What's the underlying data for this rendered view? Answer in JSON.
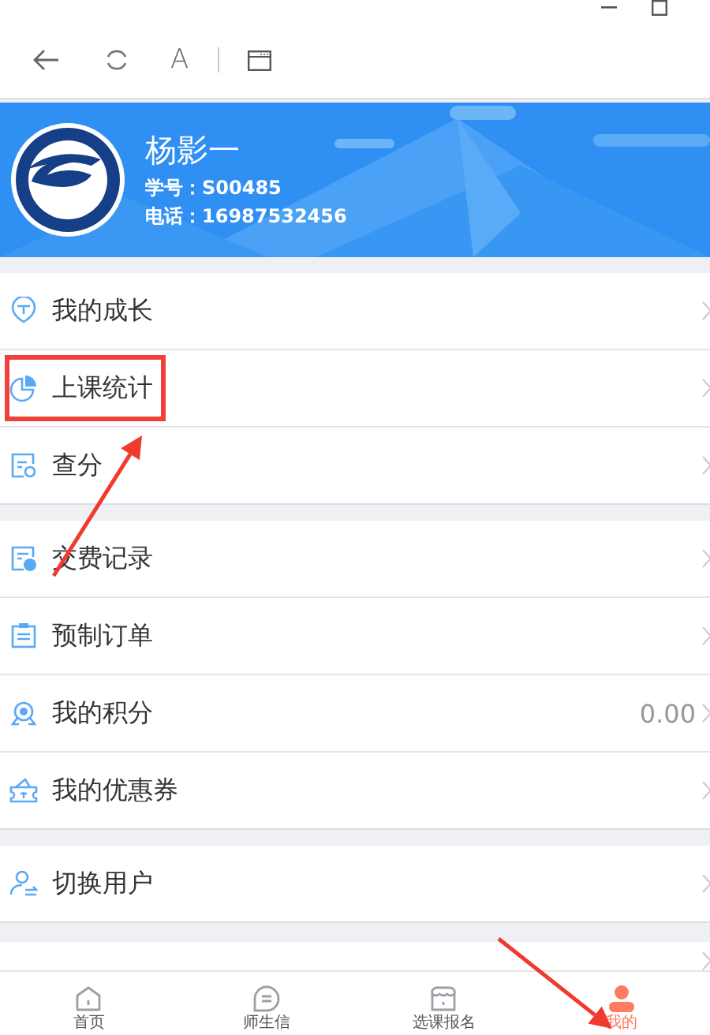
{
  "toolbar": {
    "font_button": "A"
  },
  "profile": {
    "name": "杨影一",
    "student_id": "学号：S00485",
    "phone": "电话：16987532456"
  },
  "menu_groups": [
    {
      "items": [
        {
          "label": "我的成长",
          "highlighted": false
        },
        {
          "label": "上课统计",
          "highlighted": true
        },
        {
          "label": "查分",
          "highlighted": false
        }
      ]
    },
    {
      "items": [
        {
          "label": "交费记录",
          "highlighted": false
        },
        {
          "label": "预制订单",
          "highlighted": false
        },
        {
          "label": "我的积分",
          "value": "0.00",
          "highlighted": false
        },
        {
          "label": "我的优惠券",
          "highlighted": false
        }
      ]
    },
    {
      "items": [
        {
          "label": "切换用户",
          "highlighted": false
        }
      ]
    }
  ],
  "annotations": [
    {
      "kind": "arrow"
    },
    {
      "kind": "arrow"
    }
  ],
  "tab_bar": [
    {
      "label": "首页",
      "selected": false
    },
    {
      "label": "师生信",
      "selected": false
    },
    {
      "label": "选课报名",
      "selected": false
    },
    {
      "label": "我的",
      "selected": true
    }
  ]
}
